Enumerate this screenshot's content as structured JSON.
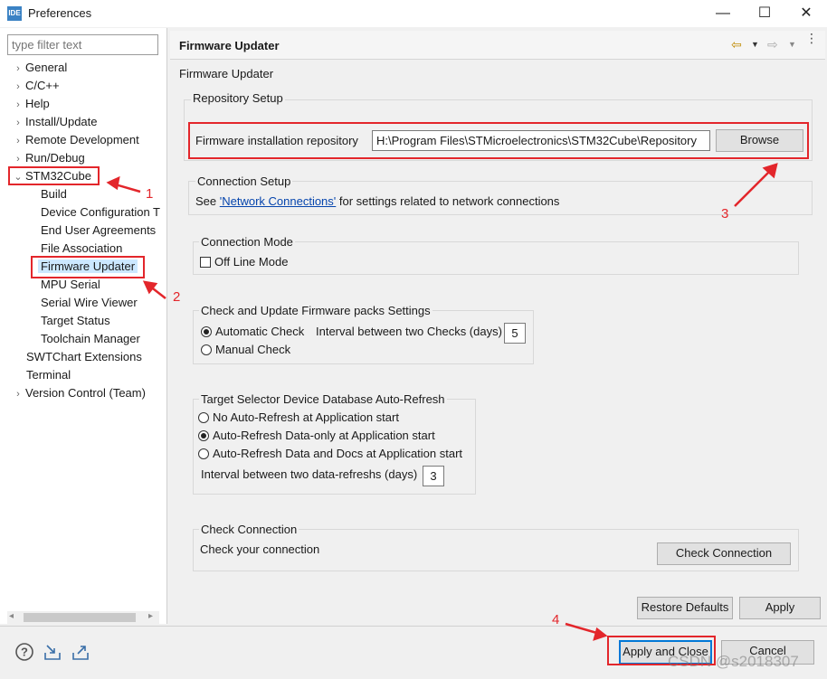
{
  "window": {
    "title": "Preferences",
    "app_icon_label": "IDE",
    "minimize_glyph": "—",
    "maximize_glyph": "☐",
    "close_glyph": "✕"
  },
  "filter": {
    "placeholder": "type filter text"
  },
  "tree": {
    "items": [
      {
        "label": "General",
        "expandable": true
      },
      {
        "label": "C/C++",
        "expandable": true
      },
      {
        "label": "Help",
        "expandable": true
      },
      {
        "label": "Install/Update",
        "expandable": true
      },
      {
        "label": "Remote Development",
        "expandable": true
      },
      {
        "label": "Run/Debug",
        "expandable": true
      },
      {
        "label": "STM32Cube",
        "expanded": true
      },
      {
        "label": "Build"
      },
      {
        "label": "Device Configuration T"
      },
      {
        "label": "End User Agreements"
      },
      {
        "label": "File Association"
      },
      {
        "label": "Firmware Updater",
        "selected": true
      },
      {
        "label": "MPU Serial"
      },
      {
        "label": "Serial Wire Viewer"
      },
      {
        "label": "Target Status"
      },
      {
        "label": "Toolchain Manager"
      },
      {
        "label": "SWTChart Extensions"
      },
      {
        "label": "Terminal"
      },
      {
        "label": "Version Control (Team)",
        "expandable": true
      }
    ]
  },
  "page": {
    "title": "Firmware Updater",
    "subtitle": "Firmware Updater"
  },
  "repository": {
    "group_label": "Repository Setup",
    "field_label": "Firmware installation repository",
    "field_value": "H:\\Program Files\\STMicroelectronics\\STM32Cube\\Repository",
    "browse_label": "Browse"
  },
  "connection": {
    "group_label": "Connection Setup",
    "text_before": "See ",
    "link_text": "'Network Connections'",
    "text_after": " for settings related to network connections"
  },
  "connection_mode": {
    "group_label": "Connection Mode",
    "offline_label": "Off Line Mode",
    "offline_checked": false
  },
  "packs": {
    "group_label": "Check and Update Firmware packs Settings",
    "automatic_label": "Automatic Check",
    "interval_label": "Interval between two Checks (days)",
    "interval_value": "5",
    "manual_label": "Manual Check",
    "selected": "automatic"
  },
  "target_selector": {
    "group_label": "Target Selector Device Database Auto-Refresh",
    "option_none": "No Auto-Refresh at Application start",
    "option_data": "Auto-Refresh Data-only at Application start",
    "option_docs": "Auto-Refresh Data and Docs at Application start",
    "selected": "data",
    "interval_label": "Interval between two data-refreshs (days)",
    "interval_value": "3"
  },
  "check_connection": {
    "group_label": "Check Connection",
    "text": "Check your connection",
    "button_label": "Check Connection"
  },
  "actions": {
    "restore_defaults": "Restore Defaults",
    "apply": "Apply",
    "apply_and_close": "Apply and Close",
    "cancel": "Cancel"
  },
  "annotations": {
    "n1": "1",
    "n2": "2",
    "n3": "3",
    "n4": "4",
    "color": "#e3262b"
  },
  "watermark": "CSDN @s2018307",
  "icons": {
    "help": "help-icon",
    "import": "import-icon",
    "export": "export-icon",
    "back": "back-arrow-icon",
    "forward": "forward-arrow-icon",
    "menu": "view-menu-icon"
  }
}
